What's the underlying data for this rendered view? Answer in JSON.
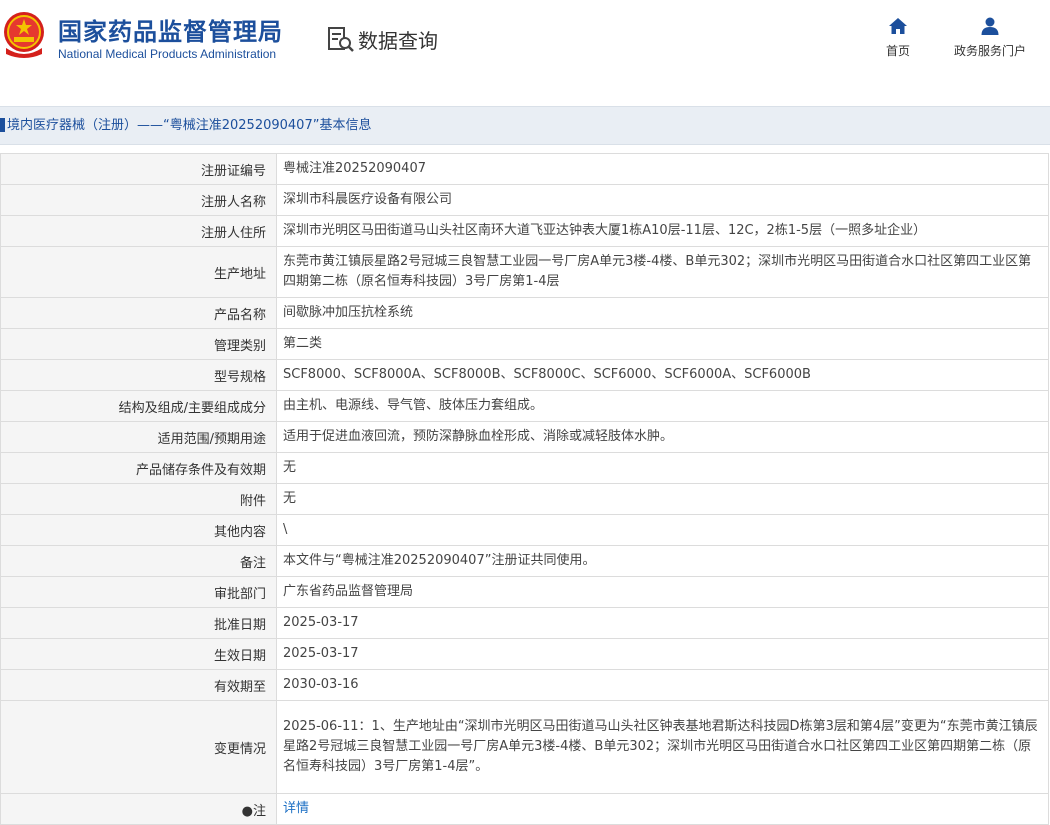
{
  "header": {
    "org_name_cn": "国家药品监督管理局",
    "org_name_en": "National Medical Products Administration",
    "section_title": "数据查询",
    "nav": [
      {
        "label": "首页",
        "icon": "home-icon"
      },
      {
        "label": "政务服务门户",
        "icon": "user-icon"
      }
    ]
  },
  "title_bar": {
    "text": "境内医疗器械（注册）——“粤械注准20252090407”基本信息"
  },
  "rows": [
    {
      "label": "注册证编号",
      "value": "粤械注准20252090407"
    },
    {
      "label": "注册人名称",
      "value": "深圳市科晨医疗设备有限公司"
    },
    {
      "label": "注册人住所",
      "value": "深圳市光明区马田街道马山头社区南环大道飞亚达钟表大厦1栋A10层-11层、12C，2栋1-5层（一照多址企业）"
    },
    {
      "label": "生产地址",
      "value": "东莞市黄江镇辰星路2号冠城三良智慧工业园一号厂房A单元3楼-4楼、B单元302；深圳市光明区马田街道合水口社区第四工业区第四期第二栋（原名恒寿科技园）3号厂房第1-4层"
    },
    {
      "label": "产品名称",
      "value": "间歇脉冲加压抗栓系统"
    },
    {
      "label": "管理类别",
      "value": "第二类"
    },
    {
      "label": "型号规格",
      "value": "SCF8000、SCF8000A、SCF8000B、SCF8000C、SCF6000、SCF6000A、SCF6000B"
    },
    {
      "label": "结构及组成/主要组成成分",
      "value": "由主机、电源线、导气管、肢体压力套组成。"
    },
    {
      "label": "适用范围/预期用途",
      "value": "适用于促进血液回流，预防深静脉血栓形成、消除或减轻肢体水肿。"
    },
    {
      "label": "产品储存条件及有效期",
      "value": "无"
    },
    {
      "label": "附件",
      "value": "无"
    },
    {
      "label": "其他内容",
      "value": "\\"
    },
    {
      "label": "备注",
      "value": "本文件与“粤械注准20252090407”注册证共同使用。"
    },
    {
      "label": "审批部门",
      "value": "广东省药品监督管理局"
    },
    {
      "label": "批准日期",
      "value": "2025-03-17"
    },
    {
      "label": "生效日期",
      "value": "2025-03-17"
    },
    {
      "label": "有效期至",
      "value": "2030-03-16"
    },
    {
      "label": "变更情况",
      "value": "2025-06-11：1、生产地址由“深圳市光明区马田街道马山头社区钟表基地君斯达科技园D栋第3层和第4层”变更为“东莞市黄江镇辰星路2号冠城三良智慧工业园一号厂房A单元3楼-4楼、B单元302；深圳市光明区马田街道合水口社区第四工业区第四期第二栋（原名恒寿科技园）3号厂房第1-4层”。"
    }
  ],
  "note_row": {
    "label": "●注",
    "link": "详情"
  }
}
